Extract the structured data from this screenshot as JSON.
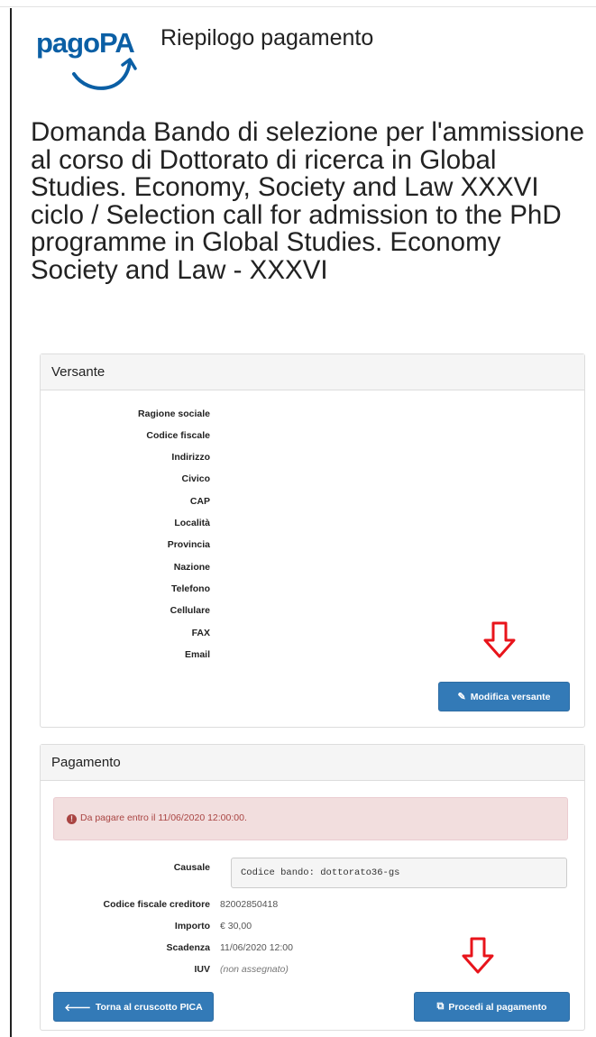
{
  "header": {
    "logo_text": "pagoPA",
    "page_title": "Riepilogo pagamento"
  },
  "description": "Domanda Bando di selezione per l'ammissione al corso di Dottorato di ricerca in Global Studies. Economy, Society and Law XXXVI ciclo / Selection call for admission to the PhD programme in Global Studies. Economy Society and Law - XXXVI",
  "versante": {
    "title": "Versante",
    "fields": [
      {
        "label": "Ragione sociale",
        "value": ""
      },
      {
        "label": "Codice fiscale",
        "value": ""
      },
      {
        "label": "Indirizzo",
        "value": ""
      },
      {
        "label": "Civico",
        "value": ""
      },
      {
        "label": "CAP",
        "value": ""
      },
      {
        "label": "Località",
        "value": ""
      },
      {
        "label": "Provincia",
        "value": ""
      },
      {
        "label": "Nazione",
        "value": ""
      },
      {
        "label": "Telefono",
        "value": ""
      },
      {
        "label": "Cellulare",
        "value": ""
      },
      {
        "label": "FAX",
        "value": ""
      },
      {
        "label": "Email",
        "value": ""
      }
    ],
    "edit_button": "Modifica versante"
  },
  "pagamento": {
    "title": "Pagamento",
    "alert": "Da pagare entro il 11/06/2020 12:00:00.",
    "causale_label": "Causale",
    "causale_value": "Codice bando: dottorato36-gs",
    "fields": [
      {
        "label": "Codice fiscale creditore",
        "value": "82002850418"
      },
      {
        "label": "Importo",
        "value": "€ 30,00"
      },
      {
        "label": "Scadenza",
        "value": "11/06/2020 12:00"
      },
      {
        "label": "IUV",
        "value": "(non assegnato)"
      }
    ],
    "back_button": "Torna al cruscotto PICA",
    "pay_button": "Procedi al pagamento"
  },
  "colors": {
    "primary": "#337ab7",
    "danger_bg": "#f2dede",
    "danger_text": "#a94442",
    "annotation_arrow": "#e8141b",
    "logo": "#0b5fa5"
  },
  "icons": {
    "edit_button": "edit-icon",
    "back_button": "arrow-left-icon",
    "pay_button": "external-link-icon",
    "alert": "exclamation-circle-icon",
    "annotation": "down-arrow-icon"
  }
}
